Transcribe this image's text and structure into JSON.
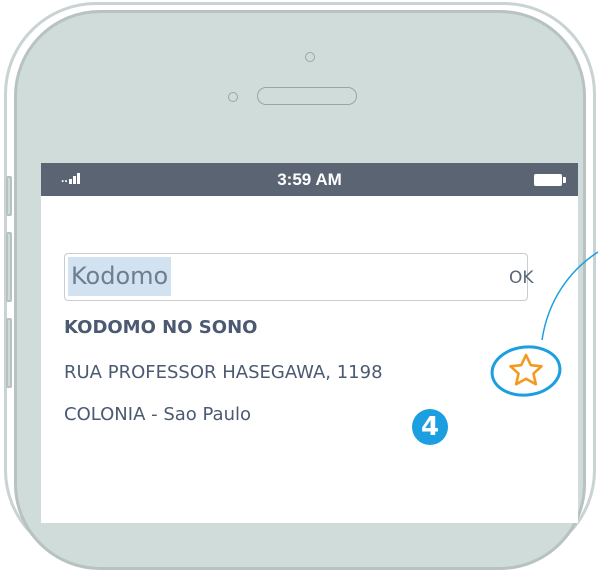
{
  "status_bar": {
    "signal_text": "..",
    "time": "3:59 AM",
    "battery_icon": "battery-full-icon"
  },
  "search": {
    "value": "Kodomo",
    "ok_label": "OK"
  },
  "result": {
    "name": "KODOMO NO SONO",
    "address": "RUA PROFESSOR HASEGAWA, 1198",
    "city": "COLONIA - Sao Paulo"
  },
  "annotation": {
    "step_number": "4",
    "favorite_icon": "star-outline-icon"
  },
  "colors": {
    "status_bar_bg": "#5a6473",
    "phone_body": "#cfdcd9",
    "accent_orange": "#f39a1f",
    "callout_blue": "#1b9fe0",
    "text_primary": "#4b5a72",
    "selection_bg": "#d2e2f1"
  }
}
